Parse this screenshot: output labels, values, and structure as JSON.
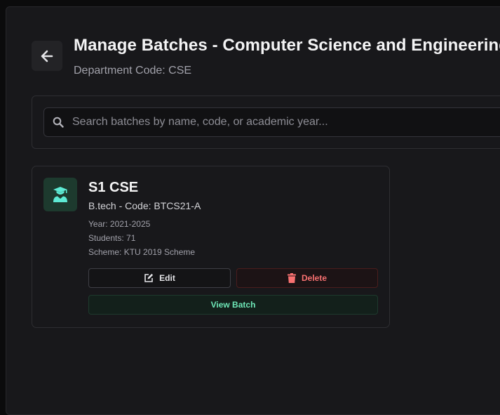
{
  "header": {
    "title": "Manage Batches - Computer Science and Engineering",
    "department_code": "Department Code: CSE",
    "back_icon": "arrow-left-icon"
  },
  "search": {
    "placeholder": "Search batches by name, code, or academic year...",
    "value": "",
    "icon": "search-icon"
  },
  "batches": [
    {
      "name": "S1 CSE",
      "subtitle": "B.tech - Code: BTCS21-A",
      "year": "Year: 2021-2025",
      "students": "Students: 71",
      "scheme": "Scheme: KTU 2019 Scheme",
      "icon": "graduate-icon",
      "actions": {
        "edit_label": "Edit",
        "delete_label": "Delete",
        "view_label": "View Batch"
      }
    }
  ],
  "colors": {
    "accent": "#6ee7b7",
    "danger": "#f87171",
    "background": "#18181b"
  }
}
